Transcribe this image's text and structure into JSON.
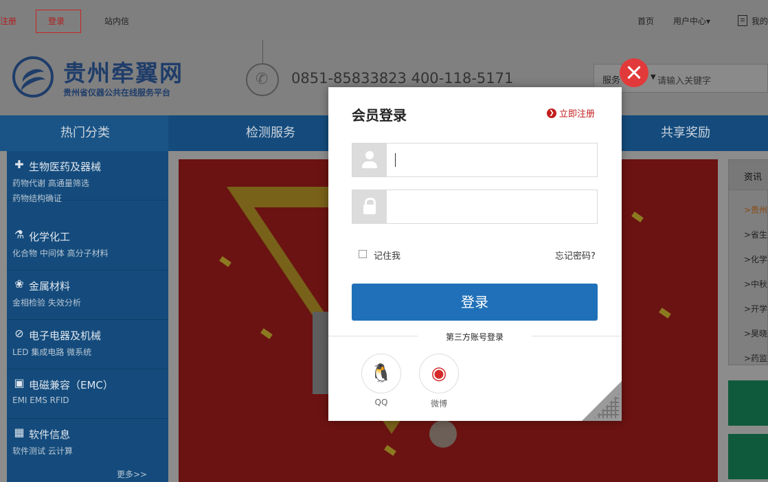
{
  "topbar": {
    "register": "注册",
    "login": "登录",
    "messages": "站内信",
    "home": "首页",
    "user_center": "用户中心▾",
    "my": "我的"
  },
  "header": {
    "logo_title": "贵州牵翼网",
    "logo_sub": "贵州省仪器公共在线服务平台",
    "phone": "0851-85833823  400-118-5171",
    "search_type": "服务",
    "search_placeholder": "请输入关键字"
  },
  "nav": {
    "hot": "热门分类",
    "items": [
      "检测服务",
      "共享奖励"
    ]
  },
  "sidebar": {
    "categories": [
      {
        "icon": "plus-circle-icon",
        "glyph": "✚",
        "title": "生物医药及器械",
        "subs": [
          "药物代谢 高通量筛选",
          "药物结构确证"
        ]
      },
      {
        "icon": "flask-icon",
        "glyph": "⚗",
        "title": "化学化工",
        "subs": [
          "化合物 中间体 高分子材料"
        ]
      },
      {
        "icon": "metal-icon",
        "glyph": "❀",
        "title": "金属材料",
        "subs": [
          "金相检验 失效分析"
        ]
      },
      {
        "icon": "chip-icon",
        "glyph": "⊘",
        "title": "电子电器及机械",
        "subs": [
          "LED 集成电路 微系统"
        ]
      },
      {
        "icon": "emc-icon",
        "glyph": "▣",
        "title": "电磁兼容（EMC）",
        "subs": [
          "EMI EMS RFID"
        ]
      },
      {
        "icon": "software-icon",
        "glyph": "▦",
        "title": "软件信息",
        "subs": [
          "软件测试 云计算"
        ]
      }
    ],
    "more": "更多>>"
  },
  "right_panel": {
    "head": "资讯",
    "links": [
      ">贵州",
      ">省生",
      ">化学",
      ">中秋",
      ">开学",
      ">昊晓",
      ">药监"
    ]
  },
  "modal": {
    "title": "会员登录",
    "register_link": "立即注册",
    "username_value": "",
    "password_value": "",
    "remember": "记住我",
    "forgot": "忘记密码?",
    "login_button": "登录",
    "third_party": "第三方账号登录",
    "qq": "QQ",
    "weibo": "微博"
  }
}
